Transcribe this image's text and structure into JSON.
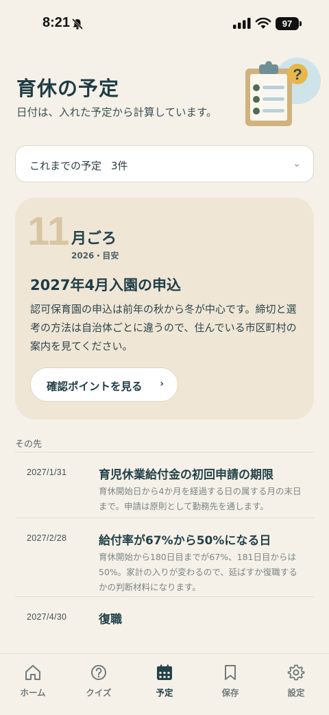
{
  "status_bar": {
    "time": "8:21",
    "battery": "97"
  },
  "header": {
    "title": "育休の予定",
    "subtitle": "日付は、入れた予定から計算しています。"
  },
  "history_dropdown": {
    "label": "これまでの予定",
    "count": "3件",
    "chevron": "⌄"
  },
  "featured": {
    "month": "11",
    "month_suffix": "月ごろ",
    "meta": "2026・目安",
    "title": "2027年4月入園の申込",
    "body": "認可保育園の申込は前年の秋から冬が中心です。締切と選考の方法は自治体ごとに違うので、住んでいる市区町村の案内を見てください。",
    "button_label": "確認ポイントを見る",
    "button_arrow": "›"
  },
  "upcoming": {
    "section_label": "その先",
    "items": [
      {
        "date": "2027/1/31",
        "title": "育児休業給付金の初回申請の期限",
        "desc": "育休開始日から4か月を経過する日の属する月の末日まで。申請は原則として勤務先を通します。"
      },
      {
        "date": "2027/2/28",
        "title": "給付率が67%から50%になる日",
        "desc": "育休開始から180日目までが67%、181日目からは50%。家計の入りが変わるので、延ばすか復職するかの判断材料になります。"
      },
      {
        "date": "2027/4/30",
        "title": "復職",
        "desc": ""
      }
    ]
  },
  "tabs": [
    {
      "label": "ホーム",
      "icon": "home-icon",
      "active": false
    },
    {
      "label": "クイズ",
      "icon": "question-icon",
      "active": false
    },
    {
      "label": "予定",
      "icon": "calendar-icon",
      "active": true
    },
    {
      "label": "保存",
      "icon": "bookmark-icon",
      "active": false
    },
    {
      "label": "設定",
      "icon": "gear-icon",
      "active": false
    }
  ],
  "colors": {
    "background": "#f6f1e8",
    "card": "#efe6d6",
    "primary_text": "#1f3d46",
    "accent_month": "#d8c6a3"
  }
}
